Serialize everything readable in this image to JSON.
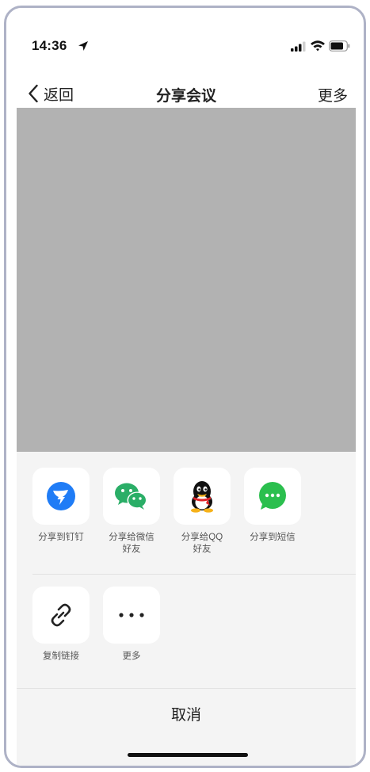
{
  "status_bar": {
    "time": "14:36"
  },
  "nav": {
    "back_label": "返回",
    "title": "分享会议",
    "more_label": "更多"
  },
  "share_row1": [
    {
      "label": "分享到钉钉",
      "icon": "dingtalk-icon",
      "color": "#1f7cf6"
    },
    {
      "label": "分享给微信\n好友",
      "icon": "wechat-icon",
      "color": "#2aae67"
    },
    {
      "label": "分享给QQ\n好友",
      "icon": "qq-icon",
      "color": "#111111"
    },
    {
      "label": "分享到短信",
      "icon": "sms-icon",
      "color": "#2bbf4e"
    }
  ],
  "share_row2": [
    {
      "label": "复制链接",
      "icon": "link-icon"
    },
    {
      "label": "更多",
      "icon": "more-dots-icon"
    }
  ],
  "cancel_label": "取消"
}
